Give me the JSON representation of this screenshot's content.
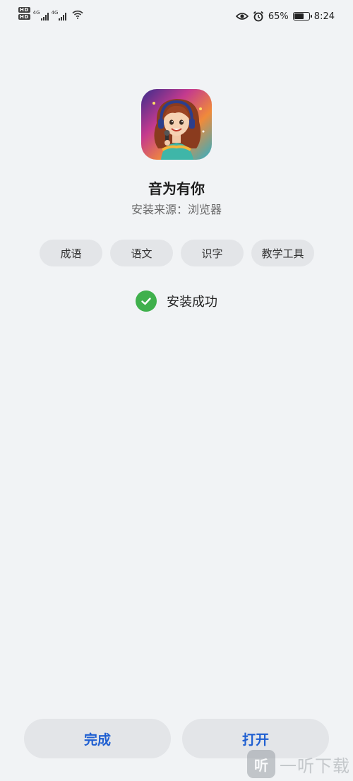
{
  "status_bar": {
    "sim1_badge": "HD",
    "sim2_badge": "HD",
    "network1": "4G",
    "network2": "4G",
    "battery_percent": "65%",
    "battery_level": 0.65,
    "time": "8:24",
    "icons": [
      "eye-icon",
      "alarm-icon",
      "battery-icon",
      "wifi-icon",
      "signal-icon"
    ]
  },
  "app": {
    "name": "音为有你",
    "install_source": "安装来源：浏览器",
    "icon": "app-icon-girl-with-headphones"
  },
  "tags": [
    {
      "label": "成语"
    },
    {
      "label": "语文"
    },
    {
      "label": "识字"
    },
    {
      "label": "教学工具"
    }
  ],
  "status": {
    "text": "安装成功",
    "icon": "check-circle-icon",
    "color": "#3fb04c"
  },
  "actions": {
    "done_label": "完成",
    "open_label": "打开",
    "accent_color": "#1f5fd1"
  },
  "watermark": {
    "logo_text": "听",
    "text": "一听下载"
  }
}
